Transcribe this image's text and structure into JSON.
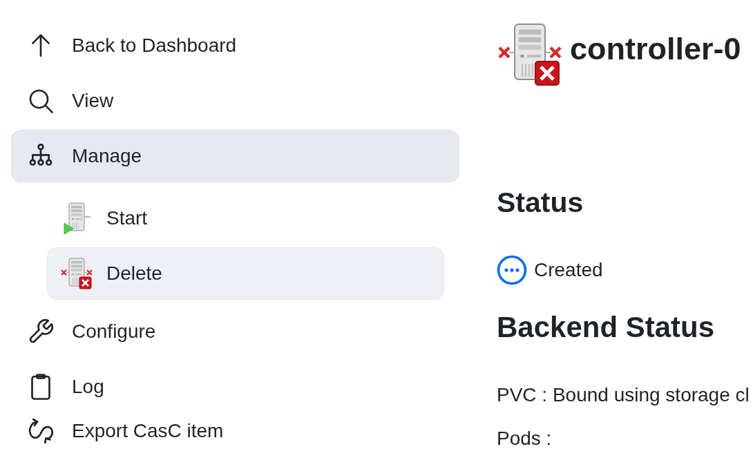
{
  "sidebar": {
    "items": [
      {
        "label": "Back to Dashboard",
        "selected": false
      },
      {
        "label": "View",
        "selected": false
      },
      {
        "label": "Manage",
        "selected": true,
        "children": [
          {
            "label": "Start",
            "selected": false
          },
          {
            "label": "Delete",
            "selected": true
          }
        ]
      },
      {
        "label": "Configure",
        "selected": false
      },
      {
        "label": "Log",
        "selected": false
      },
      {
        "label": "Export CasC item",
        "selected": false
      }
    ]
  },
  "main": {
    "title": "controller-0",
    "status": {
      "heading": "Status",
      "value": "Created"
    },
    "backend_status": {
      "heading": "Backend Status",
      "lines": [
        "PVC : Bound using storage cl",
        "Pods :"
      ]
    }
  }
}
